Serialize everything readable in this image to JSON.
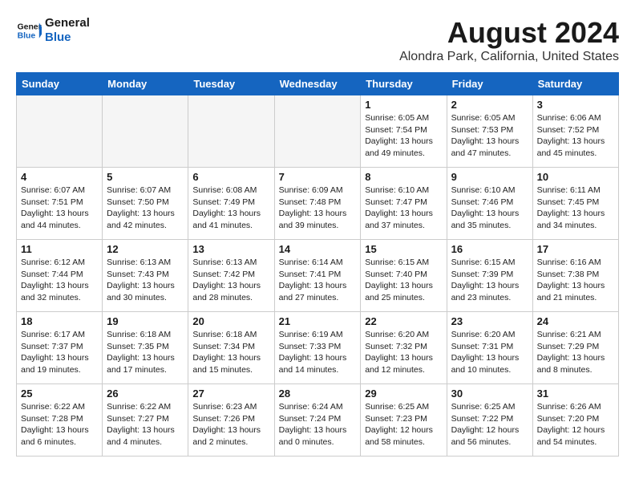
{
  "header": {
    "logo_line1": "General",
    "logo_line2": "Blue",
    "month_title": "August 2024",
    "location": "Alondra Park, California, United States"
  },
  "weekdays": [
    "Sunday",
    "Monday",
    "Tuesday",
    "Wednesday",
    "Thursday",
    "Friday",
    "Saturday"
  ],
  "weeks": [
    [
      {
        "day": "",
        "info": ""
      },
      {
        "day": "",
        "info": ""
      },
      {
        "day": "",
        "info": ""
      },
      {
        "day": "",
        "info": ""
      },
      {
        "day": "1",
        "info": "Sunrise: 6:05 AM\nSunset: 7:54 PM\nDaylight: 13 hours\nand 49 minutes."
      },
      {
        "day": "2",
        "info": "Sunrise: 6:05 AM\nSunset: 7:53 PM\nDaylight: 13 hours\nand 47 minutes."
      },
      {
        "day": "3",
        "info": "Sunrise: 6:06 AM\nSunset: 7:52 PM\nDaylight: 13 hours\nand 45 minutes."
      }
    ],
    [
      {
        "day": "4",
        "info": "Sunrise: 6:07 AM\nSunset: 7:51 PM\nDaylight: 13 hours\nand 44 minutes."
      },
      {
        "day": "5",
        "info": "Sunrise: 6:07 AM\nSunset: 7:50 PM\nDaylight: 13 hours\nand 42 minutes."
      },
      {
        "day": "6",
        "info": "Sunrise: 6:08 AM\nSunset: 7:49 PM\nDaylight: 13 hours\nand 41 minutes."
      },
      {
        "day": "7",
        "info": "Sunrise: 6:09 AM\nSunset: 7:48 PM\nDaylight: 13 hours\nand 39 minutes."
      },
      {
        "day": "8",
        "info": "Sunrise: 6:10 AM\nSunset: 7:47 PM\nDaylight: 13 hours\nand 37 minutes."
      },
      {
        "day": "9",
        "info": "Sunrise: 6:10 AM\nSunset: 7:46 PM\nDaylight: 13 hours\nand 35 minutes."
      },
      {
        "day": "10",
        "info": "Sunrise: 6:11 AM\nSunset: 7:45 PM\nDaylight: 13 hours\nand 34 minutes."
      }
    ],
    [
      {
        "day": "11",
        "info": "Sunrise: 6:12 AM\nSunset: 7:44 PM\nDaylight: 13 hours\nand 32 minutes."
      },
      {
        "day": "12",
        "info": "Sunrise: 6:13 AM\nSunset: 7:43 PM\nDaylight: 13 hours\nand 30 minutes."
      },
      {
        "day": "13",
        "info": "Sunrise: 6:13 AM\nSunset: 7:42 PM\nDaylight: 13 hours\nand 28 minutes."
      },
      {
        "day": "14",
        "info": "Sunrise: 6:14 AM\nSunset: 7:41 PM\nDaylight: 13 hours\nand 27 minutes."
      },
      {
        "day": "15",
        "info": "Sunrise: 6:15 AM\nSunset: 7:40 PM\nDaylight: 13 hours\nand 25 minutes."
      },
      {
        "day": "16",
        "info": "Sunrise: 6:15 AM\nSunset: 7:39 PM\nDaylight: 13 hours\nand 23 minutes."
      },
      {
        "day": "17",
        "info": "Sunrise: 6:16 AM\nSunset: 7:38 PM\nDaylight: 13 hours\nand 21 minutes."
      }
    ],
    [
      {
        "day": "18",
        "info": "Sunrise: 6:17 AM\nSunset: 7:37 PM\nDaylight: 13 hours\nand 19 minutes."
      },
      {
        "day": "19",
        "info": "Sunrise: 6:18 AM\nSunset: 7:35 PM\nDaylight: 13 hours\nand 17 minutes."
      },
      {
        "day": "20",
        "info": "Sunrise: 6:18 AM\nSunset: 7:34 PM\nDaylight: 13 hours\nand 15 minutes."
      },
      {
        "day": "21",
        "info": "Sunrise: 6:19 AM\nSunset: 7:33 PM\nDaylight: 13 hours\nand 14 minutes."
      },
      {
        "day": "22",
        "info": "Sunrise: 6:20 AM\nSunset: 7:32 PM\nDaylight: 13 hours\nand 12 minutes."
      },
      {
        "day": "23",
        "info": "Sunrise: 6:20 AM\nSunset: 7:31 PM\nDaylight: 13 hours\nand 10 minutes."
      },
      {
        "day": "24",
        "info": "Sunrise: 6:21 AM\nSunset: 7:29 PM\nDaylight: 13 hours\nand 8 minutes."
      }
    ],
    [
      {
        "day": "25",
        "info": "Sunrise: 6:22 AM\nSunset: 7:28 PM\nDaylight: 13 hours\nand 6 minutes."
      },
      {
        "day": "26",
        "info": "Sunrise: 6:22 AM\nSunset: 7:27 PM\nDaylight: 13 hours\nand 4 minutes."
      },
      {
        "day": "27",
        "info": "Sunrise: 6:23 AM\nSunset: 7:26 PM\nDaylight: 13 hours\nand 2 minutes."
      },
      {
        "day": "28",
        "info": "Sunrise: 6:24 AM\nSunset: 7:24 PM\nDaylight: 13 hours\nand 0 minutes."
      },
      {
        "day": "29",
        "info": "Sunrise: 6:25 AM\nSunset: 7:23 PM\nDaylight: 12 hours\nand 58 minutes."
      },
      {
        "day": "30",
        "info": "Sunrise: 6:25 AM\nSunset: 7:22 PM\nDaylight: 12 hours\nand 56 minutes."
      },
      {
        "day": "31",
        "info": "Sunrise: 6:26 AM\nSunset: 7:20 PM\nDaylight: 12 hours\nand 54 minutes."
      }
    ]
  ]
}
